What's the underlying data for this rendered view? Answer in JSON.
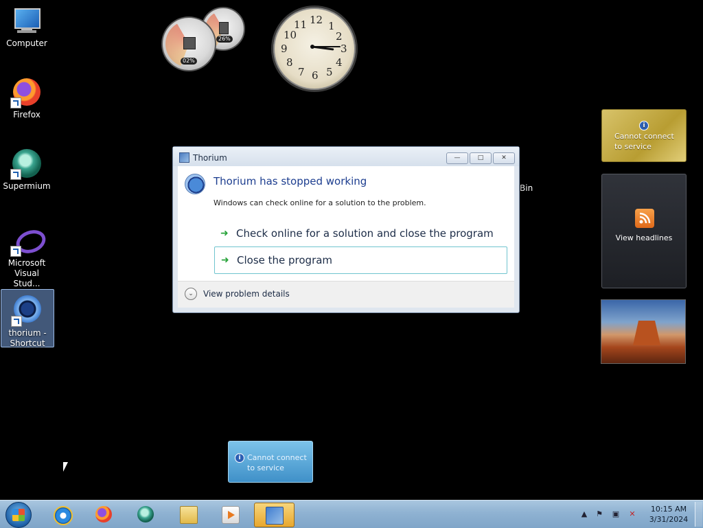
{
  "desktop": {
    "icons": [
      {
        "label": "Computer"
      },
      {
        "label": "Firefox"
      },
      {
        "label": "Supermium"
      },
      {
        "label": "Microsoft Visual Stud..."
      },
      {
        "label": "thorium - Shortcut"
      }
    ],
    "partial_text": "Bin"
  },
  "gadgets": {
    "cpu_meter": {
      "cpu_percent": "02%",
      "ram_percent": "26%"
    },
    "clock": {
      "hour": 3,
      "minute": 15,
      "numbers": [
        "12",
        "1",
        "2",
        "3",
        "4",
        "5",
        "6",
        "7",
        "8",
        "9",
        "10",
        "11"
      ]
    },
    "currency": {
      "text": "Cannot connect to service",
      "info_glyph": "i"
    },
    "feed": {
      "text": "View headlines"
    },
    "weather": {
      "text": "Cannot connect to service",
      "info_glyph": "i"
    }
  },
  "dialog": {
    "title": "Thorium",
    "heading": "Thorium has stopped working",
    "subtext": "Windows can check online for a solution to the problem.",
    "options": [
      {
        "label": "Check online for a solution and close the program"
      },
      {
        "label": "Close the program"
      }
    ],
    "details_label": "View problem details",
    "buttons": {
      "minimize": "—",
      "maximize": "□",
      "close": "✕"
    }
  },
  "taskbar": {
    "apps": [
      "internet-explorer",
      "firefox",
      "supermium",
      "file-explorer",
      "media-player",
      "wer-fault"
    ],
    "clock_time": "10:15 AM",
    "clock_date": "3/31/2024"
  },
  "colors": {
    "desktop_bg": "#000000",
    "dialog_heading": "#1c3d8f",
    "focus_border": "#6fc4cf",
    "taskbar": "#8fb2d2"
  }
}
